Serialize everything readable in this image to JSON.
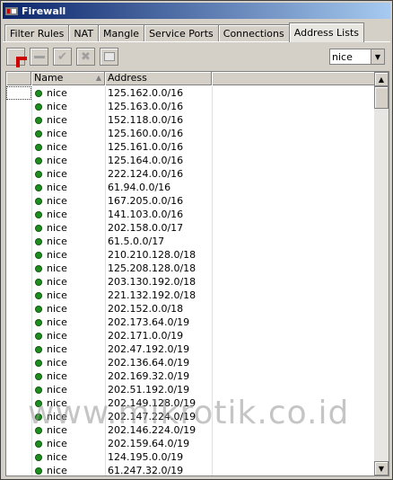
{
  "window": {
    "title": "Firewall"
  },
  "tabs": [
    {
      "label": "Filter Rules",
      "active": false
    },
    {
      "label": "NAT",
      "active": false
    },
    {
      "label": "Mangle",
      "active": false
    },
    {
      "label": "Service Ports",
      "active": false
    },
    {
      "label": "Connections",
      "active": false
    },
    {
      "label": "Address Lists",
      "active": true
    }
  ],
  "toolbar": {
    "add": "plus-icon",
    "remove": "minus-icon",
    "enable": "check-icon",
    "disable": "cross-icon",
    "comment": "note-icon"
  },
  "filter": {
    "selected": "nice"
  },
  "table": {
    "columns": [
      "",
      "Name",
      "Address"
    ],
    "rows": [
      {
        "name": "nice",
        "address": "125.162.0.0/16"
      },
      {
        "name": "nice",
        "address": "125.163.0.0/16"
      },
      {
        "name": "nice",
        "address": "152.118.0.0/16"
      },
      {
        "name": "nice",
        "address": "125.160.0.0/16"
      },
      {
        "name": "nice",
        "address": "125.161.0.0/16"
      },
      {
        "name": "nice",
        "address": "125.164.0.0/16"
      },
      {
        "name": "nice",
        "address": "222.124.0.0/16"
      },
      {
        "name": "nice",
        "address": "61.94.0.0/16"
      },
      {
        "name": "nice",
        "address": "167.205.0.0/16"
      },
      {
        "name": "nice",
        "address": "141.103.0.0/16"
      },
      {
        "name": "nice",
        "address": "202.158.0.0/17"
      },
      {
        "name": "nice",
        "address": "61.5.0.0/17"
      },
      {
        "name": "nice",
        "address": "210.210.128.0/18"
      },
      {
        "name": "nice",
        "address": "125.208.128.0/18"
      },
      {
        "name": "nice",
        "address": "203.130.192.0/18"
      },
      {
        "name": "nice",
        "address": "221.132.192.0/18"
      },
      {
        "name": "nice",
        "address": "202.152.0.0/18"
      },
      {
        "name": "nice",
        "address": "202.173.64.0/19"
      },
      {
        "name": "nice",
        "address": "202.171.0.0/19"
      },
      {
        "name": "nice",
        "address": "202.47.192.0/19"
      },
      {
        "name": "nice",
        "address": "202.136.64.0/19"
      },
      {
        "name": "nice",
        "address": "202.169.32.0/19"
      },
      {
        "name": "nice",
        "address": "202.51.192.0/19"
      },
      {
        "name": "nice",
        "address": "202.149.128.0/19"
      },
      {
        "name": "nice",
        "address": "202.147.224.0/19"
      },
      {
        "name": "nice",
        "address": "202.146.224.0/19"
      },
      {
        "name": "nice",
        "address": "202.159.64.0/19"
      },
      {
        "name": "nice",
        "address": "124.195.0.0/19"
      },
      {
        "name": "nice",
        "address": "61.247.32.0/19"
      }
    ]
  },
  "watermark": "www.mikrotik.co.id",
  "colors": {
    "titlebar": "#0a246a",
    "status_dot": "#1e8f1e",
    "add_icon": "#cc0000"
  }
}
